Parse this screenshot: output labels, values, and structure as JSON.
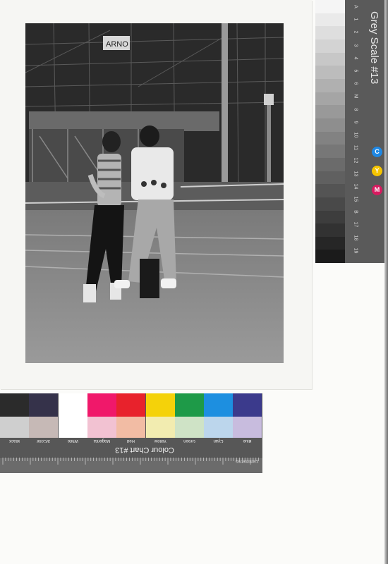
{
  "photo": {
    "sign_text": "ARNO",
    "colors": {
      "sky": "#2e2e2e",
      "ground": "#8e8e8e",
      "paper": "#f6f6f3"
    }
  },
  "grey_scale": {
    "title": "Grey Scale #13",
    "numbers": [
      "A",
      "1",
      "2",
      "3",
      "4",
      "5",
      "6",
      "M",
      "8",
      "9",
      "10",
      "11",
      "12",
      "13",
      "14",
      "15",
      "B",
      "17",
      "18",
      "19"
    ],
    "cym": [
      {
        "letter": "C",
        "color": "#1e88e5"
      },
      {
        "letter": "Y",
        "color": "#f5c400"
      },
      {
        "letter": "M",
        "color": "#d81b60"
      }
    ]
  },
  "colour_chart": {
    "title": "Colour Chart #13",
    "swatches_top": [
      "#2b2b2b",
      "#35324a",
      "#ffffff",
      "#f0186a",
      "#e8222c",
      "#f4d20a",
      "#1e9a48",
      "#1d8fe0",
      "#3b3a8c"
    ],
    "swatches_bottom": [
      "#cfcfcf",
      "#c6b9b6",
      "#ffffff",
      "#f2c2d2",
      "#f2bca4",
      "#f2ecb0",
      "#cfe3c6",
      "#bcd6ec",
      "#c8bcde"
    ],
    "swatch_names": [
      "Black",
      "3/Color",
      "White",
      "Magenta",
      "Red",
      "Yellow",
      "Green",
      "Cyan",
      "Blue"
    ],
    "ruler_label": "Centimetres"
  }
}
